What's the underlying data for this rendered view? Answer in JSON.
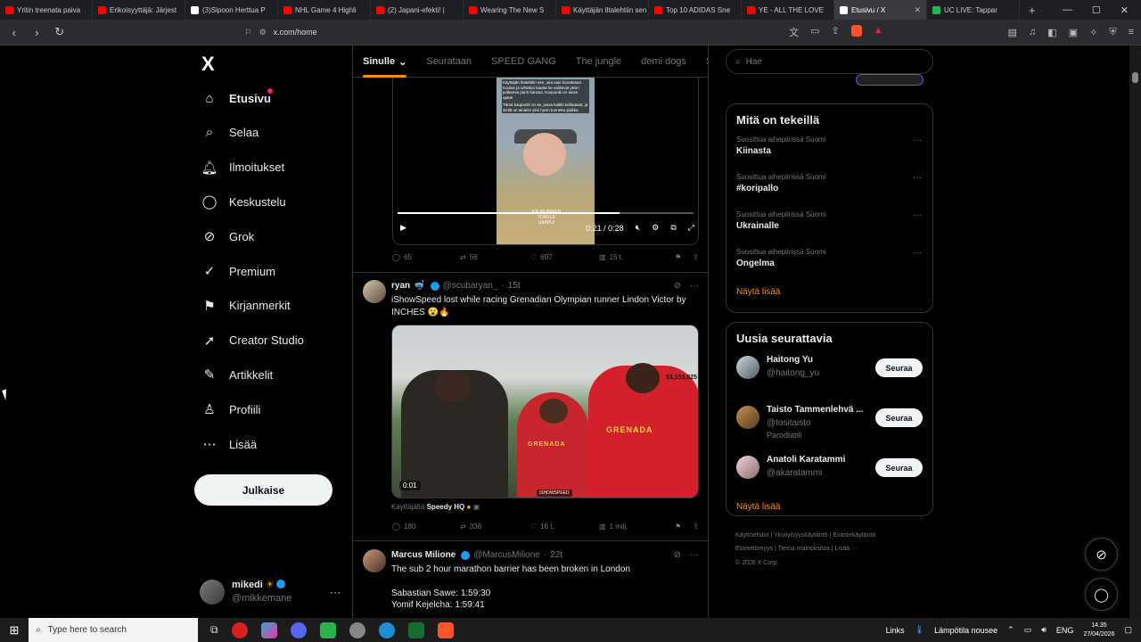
{
  "browser": {
    "tabs": [
      {
        "label": "Yritin treenata paiva",
        "color": "#ff0000",
        "active": false
      },
      {
        "label": "Erikoisyyttäjä: Järjest",
        "color": "#ff0000",
        "active": false
      },
      {
        "label": "(3)Sipoon Herttua P",
        "color": "#ffffff",
        "active": false
      },
      {
        "label": "NHL Game 4 Highli",
        "color": "#ff0000",
        "active": false
      },
      {
        "label": "(2) Japani-efekti! |",
        "color": "#ff0000",
        "active": false
      },
      {
        "label": "Wearing The New S",
        "color": "#ff0000",
        "active": false
      },
      {
        "label": "Käyttäjän Iltalehtiin sen",
        "color": "#ff0000",
        "active": false
      },
      {
        "label": "Top 10 ADIDAS Sne",
        "color": "#ff0000",
        "active": false
      },
      {
        "label": "YE - ALL THE LOVE",
        "color": "#ff0000",
        "active": false
      },
      {
        "label": "Etusivu / X",
        "color": "#ffffff",
        "active": true
      },
      {
        "label": "UC LIVE: Tappar",
        "color": "#1db954",
        "active": false
      }
    ],
    "url": "x.com/home",
    "new_tab": "+",
    "minimize": "—",
    "maximize": "☐",
    "close": "✕"
  },
  "sidebar": {
    "logo": "X",
    "items": [
      {
        "label": "Etusivu",
        "icon": "home-icon",
        "glyph": "⌂",
        "active": true
      },
      {
        "label": "Selaa",
        "icon": "search-icon",
        "glyph": "⌕",
        "active": false
      },
      {
        "label": "Ilmoitukset",
        "icon": "bell-icon",
        "glyph": "🔔︎",
        "active": false
      },
      {
        "label": "Keskustelu",
        "icon": "chat-icon",
        "glyph": "◯",
        "active": false
      },
      {
        "label": "Grok",
        "icon": "grok-icon",
        "glyph": "⊘",
        "active": false
      },
      {
        "label": "Premium",
        "icon": "premium-icon",
        "glyph": "✓",
        "active": false
      },
      {
        "label": "Kirjanmerkit",
        "icon": "bookmark-icon",
        "glyph": "⚑",
        "active": false
      },
      {
        "label": "Creator Studio",
        "icon": "rocket-icon",
        "glyph": "➚",
        "active": false
      },
      {
        "label": "Artikkelit",
        "icon": "article-icon",
        "glyph": "✎",
        "active": false
      },
      {
        "label": "Profiili",
        "icon": "profile-icon",
        "glyph": "♙",
        "active": false
      },
      {
        "label": "Lisää",
        "icon": "more-icon",
        "glyph": "⋯",
        "active": false
      }
    ],
    "post_button": "Julkaise",
    "account": {
      "name": "mikedi",
      "handle": "@mikkemane",
      "more": "···"
    }
  },
  "feed": {
    "tabs": [
      {
        "label": "Sinulle",
        "active": true,
        "chevron": "⌄"
      },
      {
        "label": "Seurataan",
        "active": false
      },
      {
        "label": "SPEED GANG",
        "active": false
      },
      {
        "label": "The jungle",
        "active": false
      },
      {
        "label": "demi dogs",
        "active": false
      },
      {
        "label": "Sportti",
        "active": false
      }
    ],
    "video_post": {
      "overlay_text": "Käyttäjän Iltalehtiin sen, jota vain korotetaan. Koulun ja urheilun kautta he valitsivat yksin poikansa parin kanssa. Kaupunki on aivan upea!",
      "overlay_text2": "Tämä kaupunki on se, jossa kaikki kohtaavat, ja siellä on ainakin yksi hyvin tunnettu paikka",
      "caption": "KAUPUNKIEN TORILLE SAAPUI",
      "time": "0:21 / 0:28",
      "progress": 0.75,
      "stats": {
        "replies": "65",
        "reposts": "56",
        "likes": "697",
        "views": "15 t."
      }
    },
    "post2": {
      "name": "ryan",
      "handle": "@scubaryan_",
      "time": "15t",
      "text": "iShowSpeed lost while racing Grenadian Olympian runner Lindon Victor by INCHES",
      "emoji": "😮🔥",
      "media_time": "0:01",
      "counter": "53,153,825",
      "shirt1": "GRENADA",
      "shirt2": "GRENADA",
      "brand": "iSHOWSPEED",
      "from_prefix": "Käyttäjältä",
      "from_name": "Speedy HQ",
      "stats": {
        "replies": "180",
        "reposts": "338",
        "likes": "16 t.",
        "views": "1 milj."
      }
    },
    "post3": {
      "name": "Marcus Milione",
      "handle": "@MarcusMilione",
      "time": "22t",
      "line1": "The sub 2 hour marathon barrier has been broken in London",
      "line2": "Sabastian Sawe:  1:59:30",
      "line3": "Yomif Kejelcha: 1:59:41"
    }
  },
  "right": {
    "search_placeholder": "Hae",
    "trends_title": "Mitä on tekeillä",
    "trends": [
      {
        "category": "Suosittua aihepiirissä Suomi",
        "title": "Kiinasta"
      },
      {
        "category": "Suosittua aihepiirissä Suomi",
        "title": "#koripallo"
      },
      {
        "category": "Suosittua aihepiirissä Suomi",
        "title": "Ukrainalle"
      },
      {
        "category": "Suosittua aihepiirissä Suomi",
        "title": "Ongelma"
      }
    ],
    "show_more": "Näytä lisää",
    "follow_title": "Uusia seurattavia",
    "follow": [
      {
        "name": "Haitong Yu",
        "handle": "@haitong_yu",
        "sub": "",
        "button": "Seuraa"
      },
      {
        "name": "Taisto Tammenlehvä ...",
        "handle": "@tositaisto",
        "sub": "Parodiatili",
        "button": "Seuraa"
      },
      {
        "name": "Anatoli Karatammi",
        "handle": "@akaratammi",
        "sub": "",
        "button": "Seuraa"
      }
    ],
    "footer": [
      "Käyttöehdot",
      "Yksityisyyskäytäntö",
      "Evästekäytäntö",
      "Esteettömyys",
      "Tietoa mainoksista",
      "Lisää ···",
      "© 2026 X Corp."
    ]
  },
  "taskbar": {
    "search_placeholder": "Type here to search",
    "links": "Links",
    "weather": "Lämpötila nousee",
    "lang": "ENG",
    "time": "14.35",
    "date": "27/04/2026"
  },
  "colors": {
    "accent": "#f4900c",
    "verified": "#1d9bf0",
    "border": "#2f3336"
  }
}
